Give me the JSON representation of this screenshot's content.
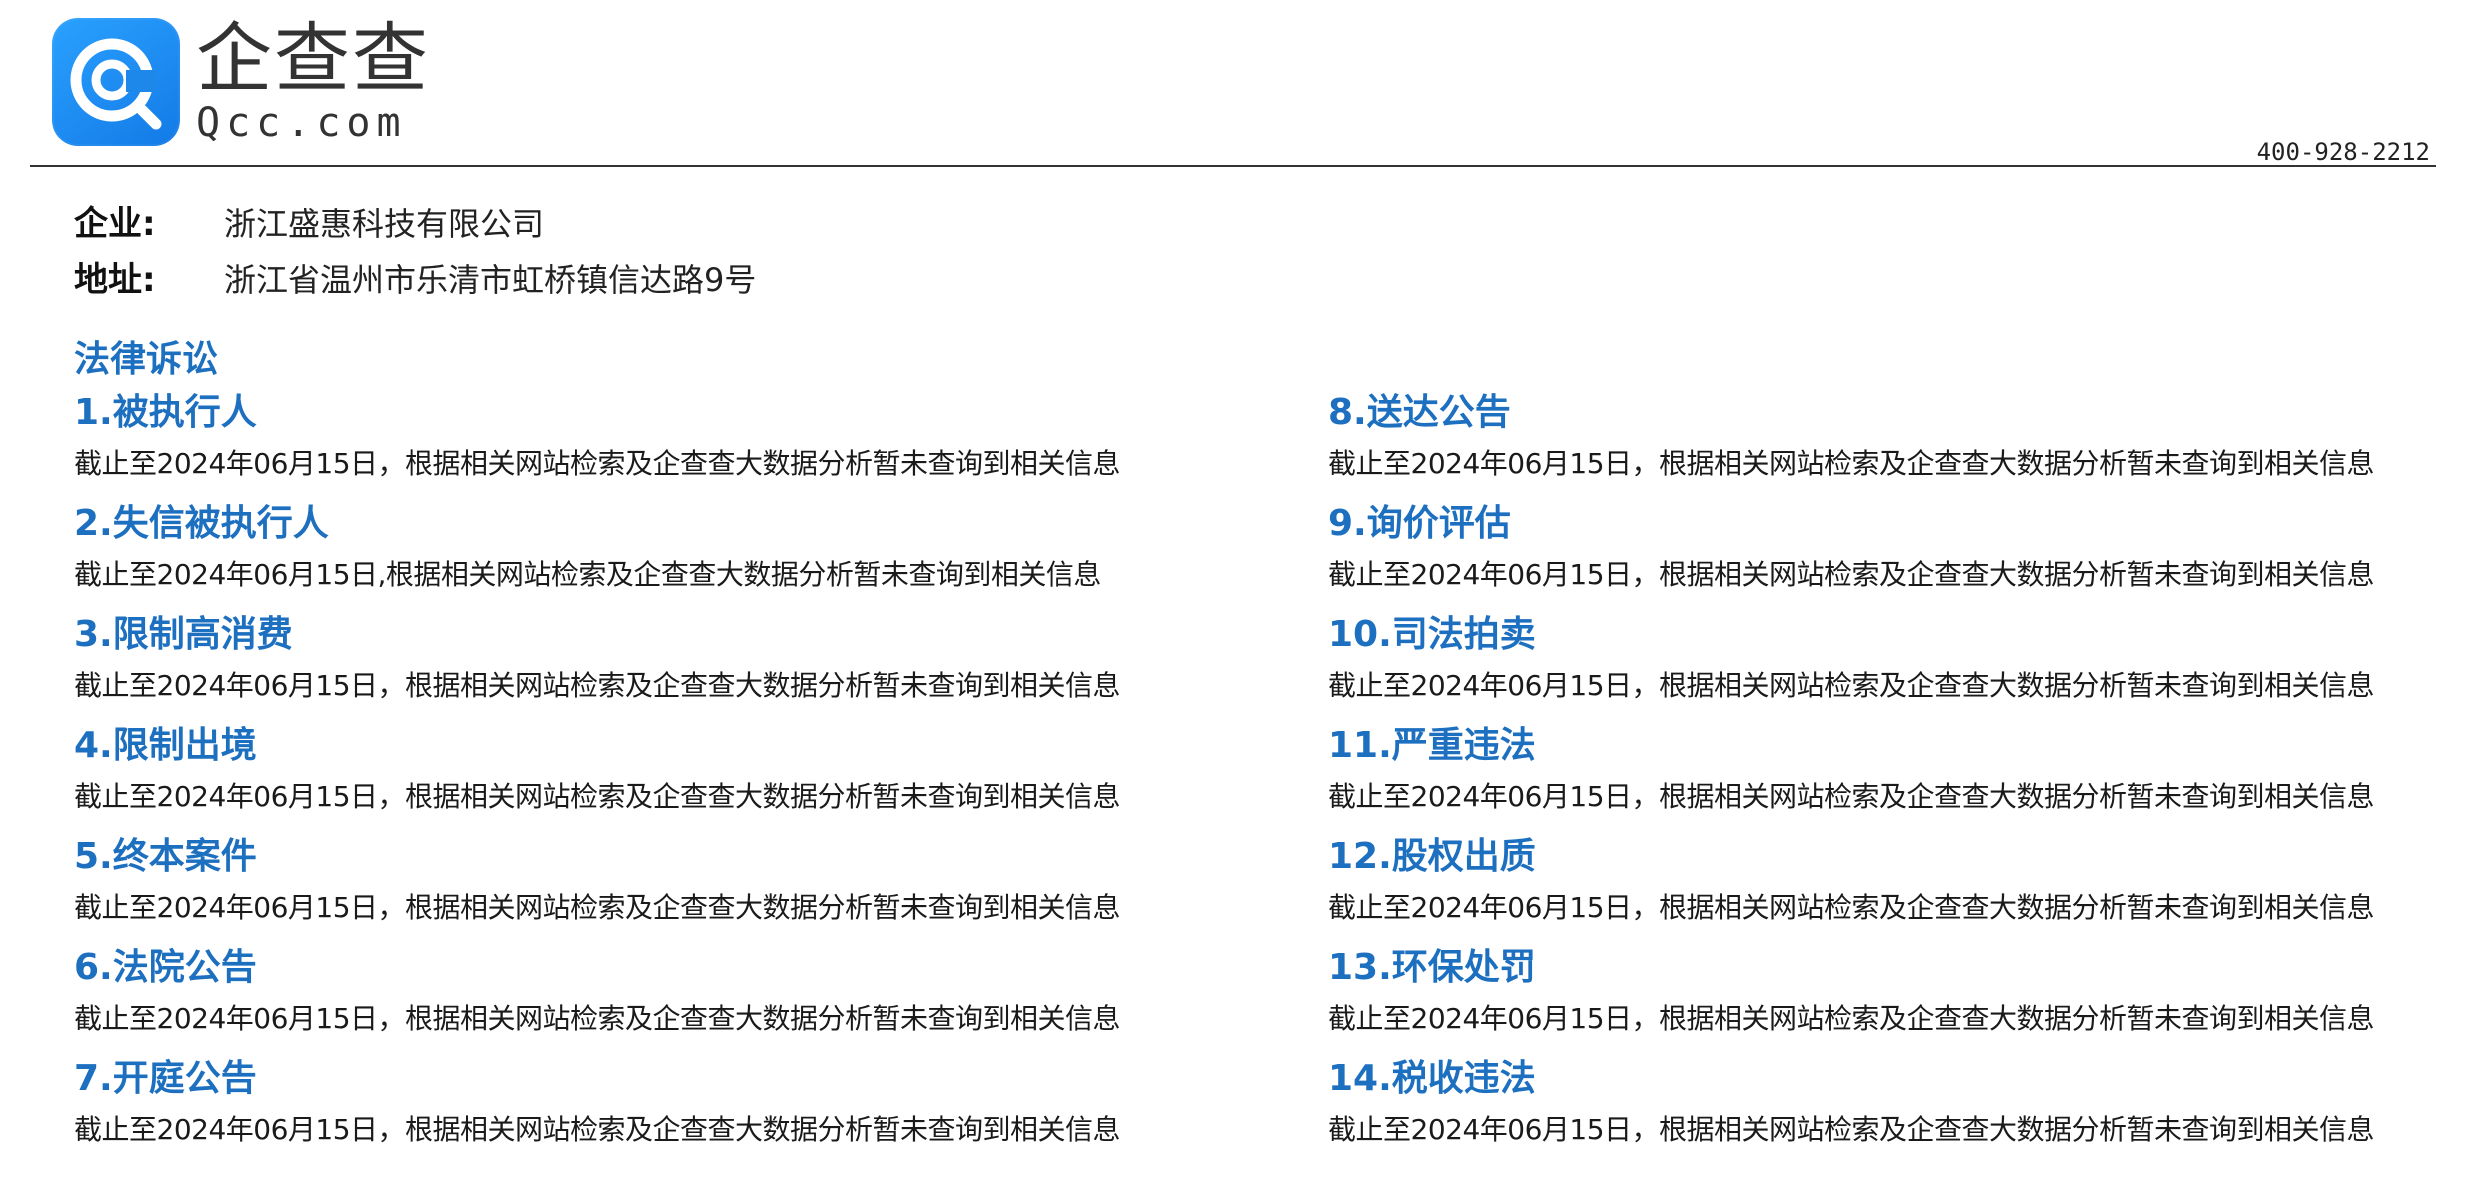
{
  "header": {
    "logo_cn": "企查查",
    "logo_en": "Qcc.com",
    "phone": "400-928-2212",
    "brand_color": "#1a8cf0"
  },
  "company": {
    "name_label": "企业:",
    "name_value": "浙江盛惠科技有限公司",
    "address_label": "地址:",
    "address_value": "浙江省温州市乐清市虹桥镇信达路9号"
  },
  "section": {
    "title": "法律诉讼",
    "accent_color": "#1d6fc0"
  },
  "items_left": [
    {
      "title": "1.被执行人",
      "desc": "截止至2024年06月15日，根据相关网站检索及企查查大数据分析暂未查询到相关信息"
    },
    {
      "title": "2.失信被执行人",
      "desc": "截止至2024年06月15日,根据相关网站检索及企查查大数据分析暂未查询到相关信息"
    },
    {
      "title": "3.限制高消费",
      "desc": "截止至2024年06月15日，根据相关网站检索及企查查大数据分析暂未查询到相关信息"
    },
    {
      "title": "4.限制出境",
      "desc": "截止至2024年06月15日，根据相关网站检索及企查查大数据分析暂未查询到相关信息"
    },
    {
      "title": "5.终本案件",
      "desc": "截止至2024年06月15日，根据相关网站检索及企查查大数据分析暂未查询到相关信息"
    },
    {
      "title": "6.法院公告",
      "desc": "截止至2024年06月15日，根据相关网站检索及企查查大数据分析暂未查询到相关信息"
    },
    {
      "title": "7.开庭公告",
      "desc": "截止至2024年06月15日，根据相关网站检索及企查查大数据分析暂未查询到相关信息"
    }
  ],
  "items_right": [
    {
      "title": "8.送达公告",
      "desc": "截止至2024年06月15日，根据相关网站检索及企查查大数据分析暂未查询到相关信息"
    },
    {
      "title": "9.询价评估",
      "desc": "截止至2024年06月15日，根据相关网站检索及企查查大数据分析暂未查询到相关信息"
    },
    {
      "title": "10.司法拍卖",
      "desc": "截止至2024年06月15日，根据相关网站检索及企查查大数据分析暂未查询到相关信息"
    },
    {
      "title": "11.严重违法",
      "desc": "截止至2024年06月15日，根据相关网站检索及企查查大数据分析暂未查询到相关信息"
    },
    {
      "title": "12.股权出质",
      "desc": "截止至2024年06月15日，根据相关网站检索及企查查大数据分析暂未查询到相关信息"
    },
    {
      "title": "13.环保处罚",
      "desc": "截止至2024年06月15日，根据相关网站检索及企查查大数据分析暂未查询到相关信息"
    },
    {
      "title": "14.税收违法",
      "desc": "截止至2024年06月15日，根据相关网站检索及企查查大数据分析暂未查询到相关信息"
    }
  ]
}
